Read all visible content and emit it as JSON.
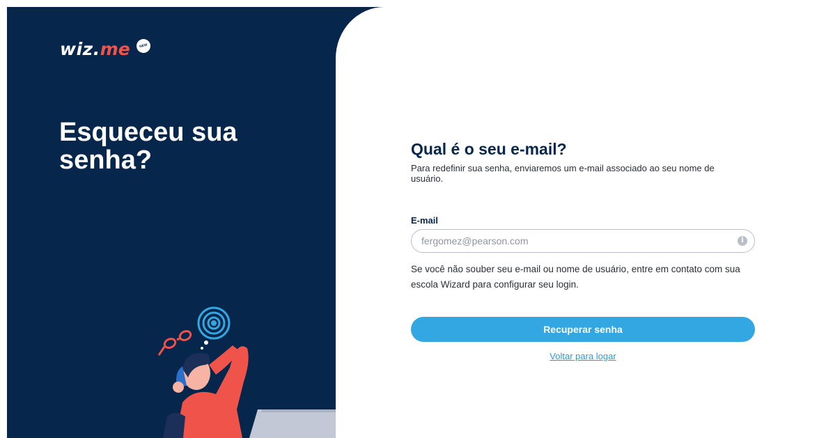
{
  "brand": {
    "logo_main": "wiz.",
    "logo_accent": "me",
    "logo_badge": "NEW",
    "colors": {
      "navy": "#06274b",
      "accent_red": "#ef5349",
      "primary_blue": "#33a7e1",
      "link_blue": "#2b9ad6"
    }
  },
  "hero": {
    "title": "Esqueceu sua senha?"
  },
  "form": {
    "title": "Qual é o seu e-mail?",
    "subtitle": "Para redefinir sua senha, enviaremos um e-mail associado ao seu nome de usuário.",
    "email_label": "E-mail",
    "email_placeholder": "fergomez@pearson.com",
    "email_value": "",
    "info_icon": "info-icon",
    "help_text": "Se você não souber seu e-mail ou nome de usuário, entre em contato com sua escola Wizard para configurar seu login.",
    "submit_label": "Recuperar senha",
    "back_link": "Voltar para logar"
  }
}
